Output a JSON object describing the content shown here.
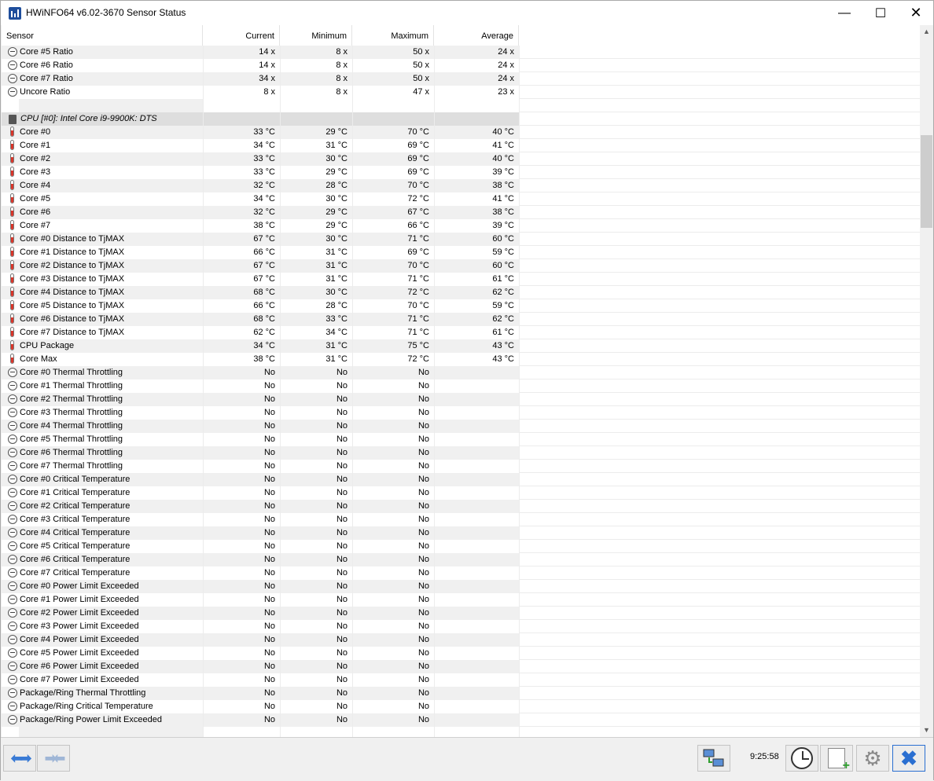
{
  "window": {
    "title": "HWiNFO64 v6.02-3670 Sensor Status"
  },
  "columns": {
    "sensor": "Sensor",
    "current": "Current",
    "minimum": "Minimum",
    "maximum": "Maximum",
    "average": "Average"
  },
  "rows": [
    {
      "icon": "gauge",
      "name": "Core #5 Ratio",
      "cur": "14 x",
      "min": "8 x",
      "max": "50 x",
      "avg": "24 x"
    },
    {
      "icon": "gauge",
      "name": "Core #6 Ratio",
      "cur": "14 x",
      "min": "8 x",
      "max": "50 x",
      "avg": "24 x"
    },
    {
      "icon": "gauge",
      "name": "Core #7 Ratio",
      "cur": "34 x",
      "min": "8 x",
      "max": "50 x",
      "avg": "24 x"
    },
    {
      "icon": "gauge",
      "name": "Uncore Ratio",
      "cur": "8 x",
      "min": "8 x",
      "max": "47 x",
      "avg": "23 x"
    },
    {
      "type": "blank"
    },
    {
      "type": "group",
      "icon": "chip",
      "name": "CPU [#0]: Intel Core i9-9900K: DTS"
    },
    {
      "icon": "thermo",
      "name": "Core #0",
      "cur": "33 °C",
      "min": "29 °C",
      "max": "70 °C",
      "avg": "40 °C"
    },
    {
      "icon": "thermo",
      "name": "Core #1",
      "cur": "34 °C",
      "min": "31 °C",
      "max": "69 °C",
      "avg": "41 °C"
    },
    {
      "icon": "thermo",
      "name": "Core #2",
      "cur": "33 °C",
      "min": "30 °C",
      "max": "69 °C",
      "avg": "40 °C"
    },
    {
      "icon": "thermo",
      "name": "Core #3",
      "cur": "33 °C",
      "min": "29 °C",
      "max": "69 °C",
      "avg": "39 °C"
    },
    {
      "icon": "thermo",
      "name": "Core #4",
      "cur": "32 °C",
      "min": "28 °C",
      "max": "70 °C",
      "avg": "38 °C"
    },
    {
      "icon": "thermo",
      "name": "Core #5",
      "cur": "34 °C",
      "min": "30 °C",
      "max": "72 °C",
      "avg": "41 °C"
    },
    {
      "icon": "thermo",
      "name": "Core #6",
      "cur": "32 °C",
      "min": "29 °C",
      "max": "67 °C",
      "avg": "38 °C"
    },
    {
      "icon": "thermo",
      "name": "Core #7",
      "cur": "38 °C",
      "min": "29 °C",
      "max": "66 °C",
      "avg": "39 °C"
    },
    {
      "icon": "thermo",
      "name": "Core #0 Distance to TjMAX",
      "cur": "67 °C",
      "min": "30 °C",
      "max": "71 °C",
      "avg": "60 °C"
    },
    {
      "icon": "thermo",
      "name": "Core #1 Distance to TjMAX",
      "cur": "66 °C",
      "min": "31 °C",
      "max": "69 °C",
      "avg": "59 °C"
    },
    {
      "icon": "thermo",
      "name": "Core #2 Distance to TjMAX",
      "cur": "67 °C",
      "min": "31 °C",
      "max": "70 °C",
      "avg": "60 °C"
    },
    {
      "icon": "thermo",
      "name": "Core #3 Distance to TjMAX",
      "cur": "67 °C",
      "min": "31 °C",
      "max": "71 °C",
      "avg": "61 °C"
    },
    {
      "icon": "thermo",
      "name": "Core #4 Distance to TjMAX",
      "cur": "68 °C",
      "min": "30 °C",
      "max": "72 °C",
      "avg": "62 °C"
    },
    {
      "icon": "thermo",
      "name": "Core #5 Distance to TjMAX",
      "cur": "66 °C",
      "min": "28 °C",
      "max": "70 °C",
      "avg": "59 °C"
    },
    {
      "icon": "thermo",
      "name": "Core #6 Distance to TjMAX",
      "cur": "68 °C",
      "min": "33 °C",
      "max": "71 °C",
      "avg": "62 °C"
    },
    {
      "icon": "thermo",
      "name": "Core #7 Distance to TjMAX",
      "cur": "62 °C",
      "min": "34 °C",
      "max": "71 °C",
      "avg": "61 °C"
    },
    {
      "icon": "thermo",
      "name": "CPU Package",
      "cur": "34 °C",
      "min": "31 °C",
      "max": "75 °C",
      "avg": "43 °C"
    },
    {
      "icon": "thermo",
      "name": "Core Max",
      "cur": "38 °C",
      "min": "31 °C",
      "max": "72 °C",
      "avg": "43 °C"
    },
    {
      "icon": "gauge",
      "name": "Core #0 Thermal Throttling",
      "cur": "No",
      "min": "No",
      "max": "No",
      "avg": ""
    },
    {
      "icon": "gauge",
      "name": "Core #1 Thermal Throttling",
      "cur": "No",
      "min": "No",
      "max": "No",
      "avg": ""
    },
    {
      "icon": "gauge",
      "name": "Core #2 Thermal Throttling",
      "cur": "No",
      "min": "No",
      "max": "No",
      "avg": ""
    },
    {
      "icon": "gauge",
      "name": "Core #3 Thermal Throttling",
      "cur": "No",
      "min": "No",
      "max": "No",
      "avg": ""
    },
    {
      "icon": "gauge",
      "name": "Core #4 Thermal Throttling",
      "cur": "No",
      "min": "No",
      "max": "No",
      "avg": ""
    },
    {
      "icon": "gauge",
      "name": "Core #5 Thermal Throttling",
      "cur": "No",
      "min": "No",
      "max": "No",
      "avg": ""
    },
    {
      "icon": "gauge",
      "name": "Core #6 Thermal Throttling",
      "cur": "No",
      "min": "No",
      "max": "No",
      "avg": ""
    },
    {
      "icon": "gauge",
      "name": "Core #7 Thermal Throttling",
      "cur": "No",
      "min": "No",
      "max": "No",
      "avg": ""
    },
    {
      "icon": "gauge",
      "name": "Core #0 Critical Temperature",
      "cur": "No",
      "min": "No",
      "max": "No",
      "avg": ""
    },
    {
      "icon": "gauge",
      "name": "Core #1 Critical Temperature",
      "cur": "No",
      "min": "No",
      "max": "No",
      "avg": ""
    },
    {
      "icon": "gauge",
      "name": "Core #2 Critical Temperature",
      "cur": "No",
      "min": "No",
      "max": "No",
      "avg": ""
    },
    {
      "icon": "gauge",
      "name": "Core #3 Critical Temperature",
      "cur": "No",
      "min": "No",
      "max": "No",
      "avg": ""
    },
    {
      "icon": "gauge",
      "name": "Core #4 Critical Temperature",
      "cur": "No",
      "min": "No",
      "max": "No",
      "avg": ""
    },
    {
      "icon": "gauge",
      "name": "Core #5 Critical Temperature",
      "cur": "No",
      "min": "No",
      "max": "No",
      "avg": ""
    },
    {
      "icon": "gauge",
      "name": "Core #6 Critical Temperature",
      "cur": "No",
      "min": "No",
      "max": "No",
      "avg": ""
    },
    {
      "icon": "gauge",
      "name": "Core #7 Critical Temperature",
      "cur": "No",
      "min": "No",
      "max": "No",
      "avg": ""
    },
    {
      "icon": "gauge",
      "name": "Core #0 Power Limit Exceeded",
      "cur": "No",
      "min": "No",
      "max": "No",
      "avg": ""
    },
    {
      "icon": "gauge",
      "name": "Core #1 Power Limit Exceeded",
      "cur": "No",
      "min": "No",
      "max": "No",
      "avg": ""
    },
    {
      "icon": "gauge",
      "name": "Core #2 Power Limit Exceeded",
      "cur": "No",
      "min": "No",
      "max": "No",
      "avg": ""
    },
    {
      "icon": "gauge",
      "name": "Core #3 Power Limit Exceeded",
      "cur": "No",
      "min": "No",
      "max": "No",
      "avg": ""
    },
    {
      "icon": "gauge",
      "name": "Core #4 Power Limit Exceeded",
      "cur": "No",
      "min": "No",
      "max": "No",
      "avg": ""
    },
    {
      "icon": "gauge",
      "name": "Core #5 Power Limit Exceeded",
      "cur": "No",
      "min": "No",
      "max": "No",
      "avg": ""
    },
    {
      "icon": "gauge",
      "name": "Core #6 Power Limit Exceeded",
      "cur": "No",
      "min": "No",
      "max": "No",
      "avg": ""
    },
    {
      "icon": "gauge",
      "name": "Core #7 Power Limit Exceeded",
      "cur": "No",
      "min": "No",
      "max": "No",
      "avg": ""
    },
    {
      "icon": "gauge",
      "name": "Package/Ring Thermal Throttling",
      "cur": "No",
      "min": "No",
      "max": "No",
      "avg": ""
    },
    {
      "icon": "gauge",
      "name": "Package/Ring Critical Temperature",
      "cur": "No",
      "min": "No",
      "max": "No",
      "avg": ""
    },
    {
      "icon": "gauge",
      "name": "Package/Ring Power Limit Exceeded",
      "cur": "No",
      "min": "No",
      "max": "No",
      "avg": ""
    },
    {
      "type": "blank"
    }
  ],
  "toolbar": {
    "timer": "9:25:58"
  },
  "icons": {
    "app": "hwinfo-app-icon",
    "gauge": "gauge-icon",
    "thermo": "thermometer-icon",
    "chip": "cpu-chip-icon",
    "nav_expand": "expand-arrows-icon",
    "nav_collapse": "collapse-arrows-icon",
    "network": "network-icon",
    "clock": "clock-icon",
    "report": "report-add-icon",
    "settings": "gear-icon",
    "close": "close-x-icon"
  },
  "colors": {
    "row_alt": "#f0f0f0",
    "group_bg": "#dedede",
    "accent": "#2a6fd1"
  }
}
